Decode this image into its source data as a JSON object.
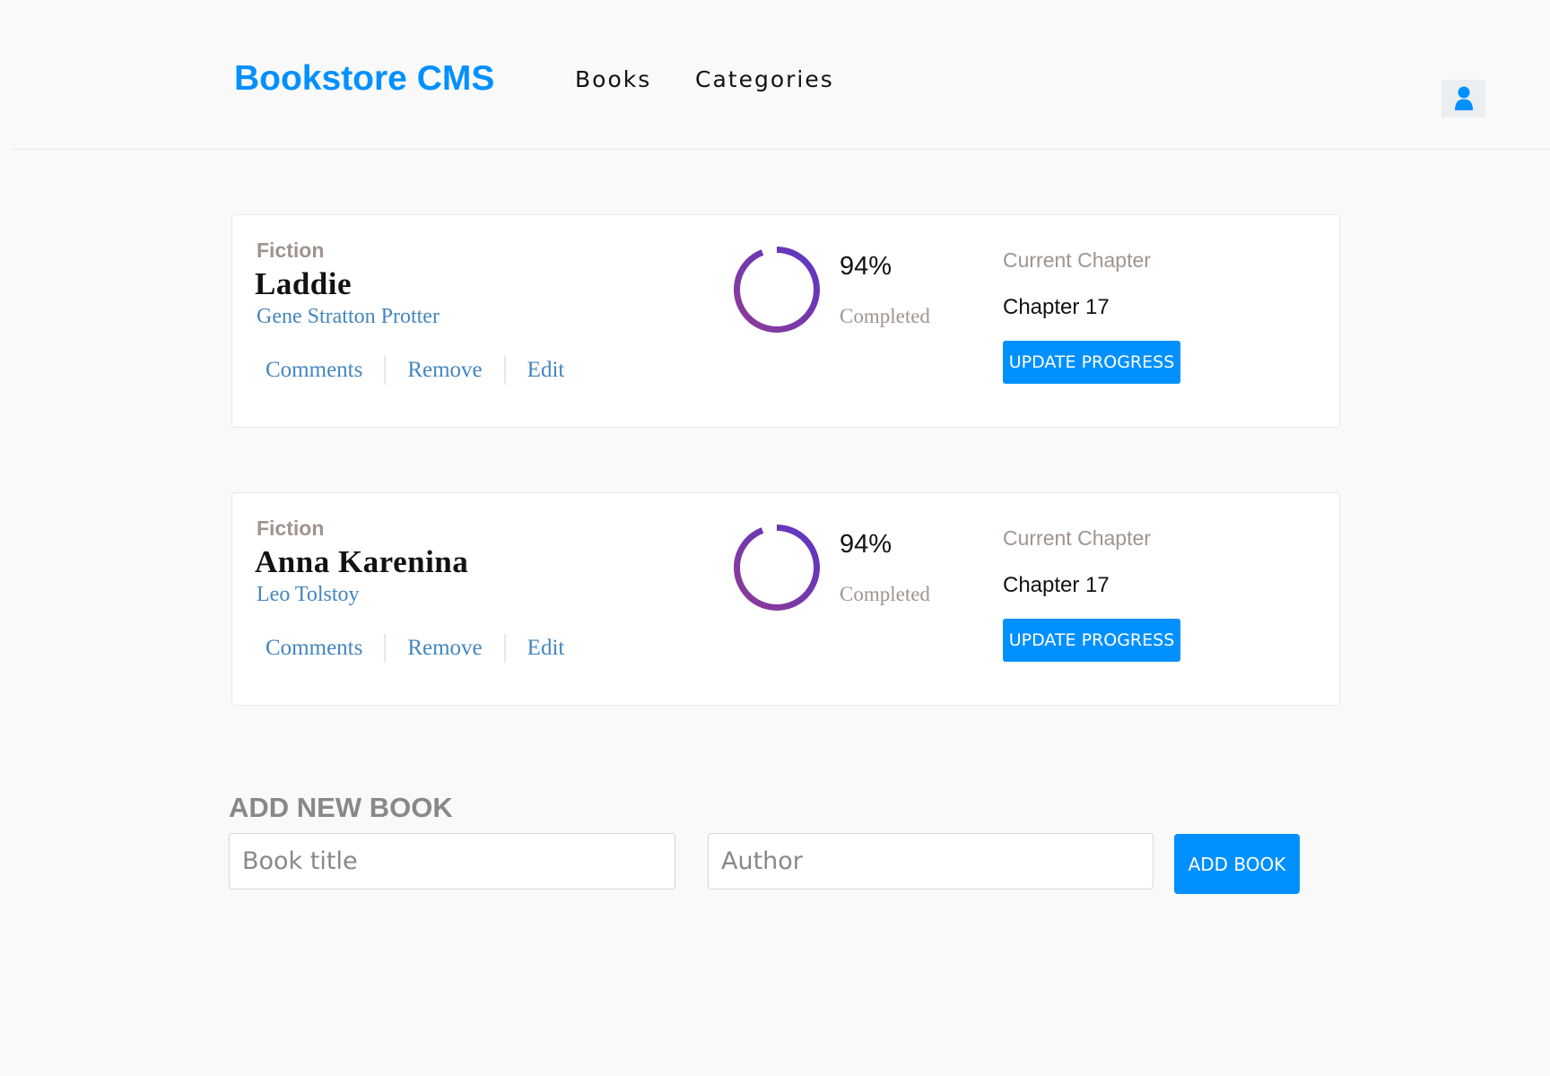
{
  "header": {
    "brand": "Bookstore CMS",
    "nav": [
      {
        "label": "Books"
      },
      {
        "label": "Categories"
      }
    ],
    "user_icon": "user-icon"
  },
  "books": [
    {
      "genre": "Fiction",
      "title": "Laddie",
      "author": "Gene Stratton Protter",
      "actions": {
        "comments": "Comments",
        "remove": "Remove",
        "edit": "Edit"
      },
      "progress_percent": 94,
      "percent_label": "94%",
      "completed_label": "Completed",
      "chapter_label": "Current Chapter",
      "chapter_value": "Chapter 17",
      "update_label": "UPDATE PROGRESS"
    },
    {
      "genre": "Fiction",
      "title": "Anna Karenina",
      "author": "Leo Tolstoy",
      "actions": {
        "comments": "Comments",
        "remove": "Remove",
        "edit": "Edit"
      },
      "progress_percent": 94,
      "percent_label": "94%",
      "completed_label": "Completed",
      "chapter_label": "Current Chapter",
      "chapter_value": "Chapter 17",
      "update_label": "UPDATE PROGRESS"
    }
  ],
  "add_book": {
    "heading": "ADD NEW BOOK",
    "title_placeholder": "Book title",
    "title_value": "",
    "author_placeholder": "Author",
    "author_value": "",
    "button_label": "ADD BOOK"
  },
  "colors": {
    "accent": "#0290ff",
    "link": "#4386bf",
    "muted": "#a0948f",
    "ring_start": "#8e3b95",
    "ring_end": "#5b37c4"
  }
}
